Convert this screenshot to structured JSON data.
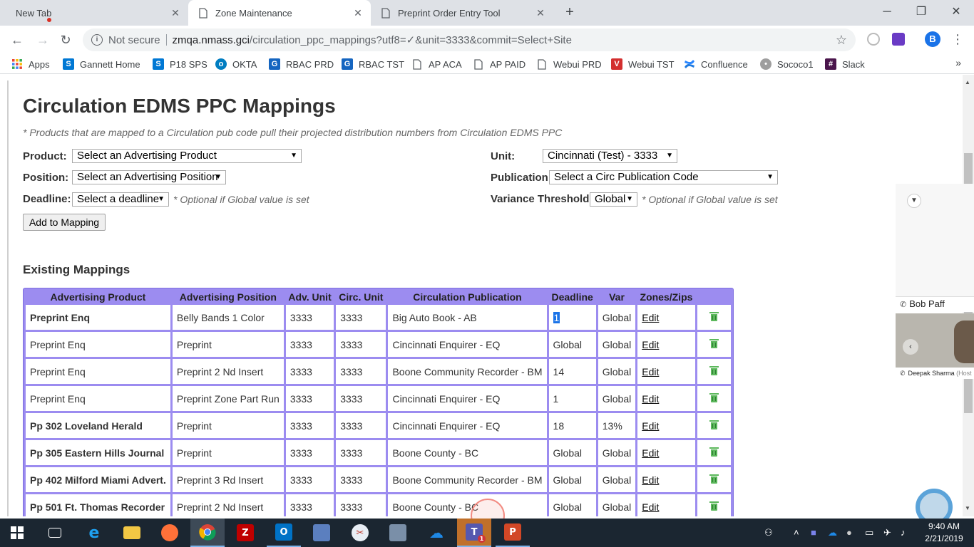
{
  "browser": {
    "tabs": [
      {
        "title": "New Tab",
        "active": false
      },
      {
        "title": "Zone Maintenance",
        "active": true
      },
      {
        "title": "Preprint Order Entry Tool",
        "active": false
      }
    ],
    "address": {
      "security": "Not secure",
      "host": "zmqa.nmass.gci",
      "path": "/circulation_ppc_mappings?utf8=✓&unit=3333&commit=Select+Site"
    },
    "profile_initial": "B",
    "bookmarks": [
      {
        "label": "Apps",
        "icon": "apps-grid-icon",
        "color": "#ea4335"
      },
      {
        "label": "Gannett Home",
        "icon": "sharepoint-icon",
        "color": "#0078d4"
      },
      {
        "label": "P18 SPS",
        "icon": "sharepoint-icon",
        "color": "#0078d4"
      },
      {
        "label": "OKTA",
        "icon": "okta-icon",
        "color": "#007dc1"
      },
      {
        "label": "RBAC PRD",
        "icon": "g-icon",
        "color": "#1565c0"
      },
      {
        "label": "RBAC TST",
        "icon": "g-icon",
        "color": "#1565c0"
      },
      {
        "label": "AP ACA",
        "icon": "page-icon",
        "color": "#5f6368"
      },
      {
        "label": "AP PAID",
        "icon": "page-icon",
        "color": "#5f6368"
      },
      {
        "label": "Webui PRD",
        "icon": "page-icon",
        "color": "#5f6368"
      },
      {
        "label": "Webui TST",
        "icon": "v-icon",
        "color": "#d32f2f"
      },
      {
        "label": "Confluence",
        "icon": "confluence-icon",
        "color": "#1f7ae0"
      },
      {
        "label": "Sococo1",
        "icon": "sococo-icon",
        "color": "#6d6d6d"
      },
      {
        "label": "Slack",
        "icon": "slack-icon",
        "color": "#4a154b"
      }
    ]
  },
  "page": {
    "title": "Circulation EDMS PPC Mappings",
    "note": "* Products that are mapped to a Circulation pub code pull their projected distribution numbers from Circulation EDMS PPC",
    "form": {
      "product_label": "Product:",
      "product_value": "Select an Advertising Product",
      "position_label": "Position:",
      "position_value": "Select an Advertising Position",
      "deadline_label": "Deadline:",
      "deadline_value": "Select a deadline",
      "deadline_note": "* Optional if Global value is set",
      "unit_label": "Unit:",
      "unit_value": "Cincinnati (Test) - 3333",
      "publication_label": "Publication:",
      "publication_value": "Select a Circ Publication Code",
      "variance_label": "Variance Threshold:",
      "variance_value": "Global",
      "variance_note": "* Optional if Global value is set",
      "add_button": "Add to Mapping"
    },
    "existing_heading": "Existing Mappings",
    "table": {
      "headers": [
        "Advertising Product",
        "Advertising Position",
        "Adv. Unit",
        "Circ. Unit",
        "Circulation Publication",
        "Deadline",
        "Var",
        "Zones/Zips",
        ""
      ],
      "rows": [
        {
          "product": "Preprint Enq",
          "bold": true,
          "position": "Belly Bands 1 Color",
          "adv_unit": "3333",
          "circ_unit": "3333",
          "publication": "Big Auto Book - AB",
          "deadline": "1",
          "var": "Global",
          "edit": "Edit"
        },
        {
          "product": "Preprint Enq",
          "bold": false,
          "position": "Preprint",
          "adv_unit": "3333",
          "circ_unit": "3333",
          "publication": "Cincinnati Enquirer - EQ",
          "deadline": "Global",
          "var": "Global",
          "edit": "Edit"
        },
        {
          "product": "Preprint Enq",
          "bold": false,
          "position": "Preprint 2 Nd Insert",
          "adv_unit": "3333",
          "circ_unit": "3333",
          "publication": "Boone Community Recorder - BM",
          "deadline": "14",
          "var": "Global",
          "edit": "Edit"
        },
        {
          "product": "Preprint Enq",
          "bold": false,
          "position": "Preprint Zone Part Run",
          "adv_unit": "3333",
          "circ_unit": "3333",
          "publication": "Cincinnati Enquirer - EQ",
          "deadline": "1",
          "var": "Global",
          "edit": "Edit"
        },
        {
          "product": "Pp 302 Loveland Herald",
          "bold": true,
          "position": "Preprint",
          "adv_unit": "3333",
          "circ_unit": "3333",
          "publication": "Cincinnati Enquirer - EQ",
          "deadline": "18",
          "var": "13%",
          "edit": "Edit"
        },
        {
          "product": "Pp 305 Eastern Hills Journal",
          "bold": true,
          "position": "Preprint",
          "adv_unit": "3333",
          "circ_unit": "3333",
          "publication": "Boone County - BC",
          "deadline": "Global",
          "var": "Global",
          "edit": "Edit"
        },
        {
          "product": "Pp 402 Milford Miami Advert.",
          "bold": true,
          "position": "Preprint 3 Rd Insert",
          "adv_unit": "3333",
          "circ_unit": "3333",
          "publication": "Boone Community Recorder - BM",
          "deadline": "Global",
          "var": "Global",
          "edit": "Edit"
        },
        {
          "product": "Pp 501 Ft. Thomas Recorder",
          "bold": true,
          "position": "Preprint 2 Nd Insert",
          "adv_unit": "3333",
          "circ_unit": "3333",
          "publication": "Boone County - BC",
          "deadline": "Global",
          "var": "Global",
          "edit": "Edit"
        }
      ]
    }
  },
  "call_panel": {
    "caller1": "Bob Paff",
    "caller2": "Deepak Sharma",
    "caller2_role": "(Host"
  },
  "taskbar": {
    "time": "9:40 AM",
    "date": "2/21/2019",
    "teams_badge": "1"
  }
}
